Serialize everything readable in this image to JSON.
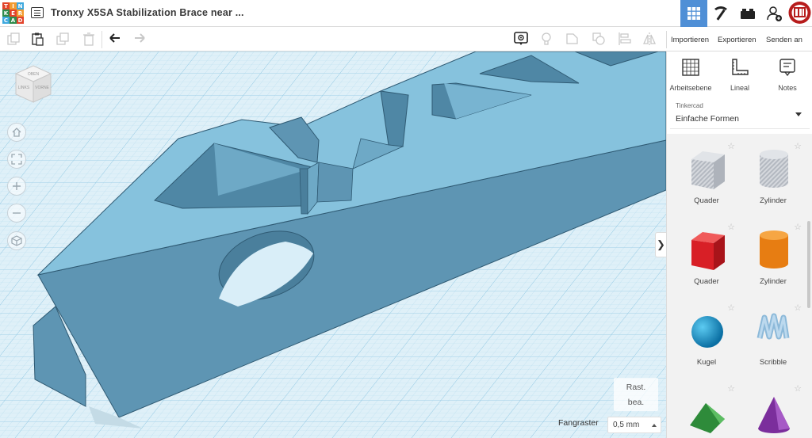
{
  "app": {
    "logo_letters": [
      "T",
      "I",
      "N",
      "K",
      "E",
      "R",
      "C",
      "A",
      "D"
    ],
    "logo_colors": [
      "#e2432a",
      "#f29b30",
      "#3ea8de",
      "#2f8c4c",
      "#e2432a",
      "#f29b30",
      "#3ea8de",
      "#2f8c4c",
      "#e2432a"
    ],
    "document_title": "Tronxy X5SA Stabilization Brace near ..."
  },
  "header_buttons": [
    {
      "name": "3d-design-view-button",
      "icon": "grid-icon",
      "active": true
    },
    {
      "name": "codeblocks-button",
      "icon": "pickaxe-icon",
      "active": false
    },
    {
      "name": "bricks-button",
      "icon": "brick-icon",
      "active": false
    },
    {
      "name": "add-user-button",
      "icon": "add-user-icon",
      "active": false
    }
  ],
  "toolbar": {
    "import_label": "Importieren",
    "export_label": "Exportieren",
    "send_label": "Senden an"
  },
  "viewport": {
    "navcube_faces": [
      "OBEN",
      "LINKS",
      "VORNE"
    ],
    "rast_label": "Rast.",
    "bea_label": "bea.",
    "snap_label": "Fangraster",
    "snap_value": "0,5 mm",
    "collapse_glyph": "❯"
  },
  "sidebar": {
    "tools": [
      {
        "label": "Arbeitsebene",
        "icon": "workplane-icon"
      },
      {
        "label": "Lineal",
        "icon": "ruler-icon"
      },
      {
        "label": "Notes",
        "icon": "notes-icon"
      }
    ],
    "library_source": "Tinkercad",
    "library_name": "Einfache Formen",
    "shapes": [
      {
        "label": "Quader",
        "icon": "hole-box-icon",
        "color": "#c9cdd4"
      },
      {
        "label": "Zylinder",
        "icon": "hole-cylinder-icon",
        "color": "#c9cdd4"
      },
      {
        "label": "Quader",
        "icon": "box-icon",
        "color": "#e0262b"
      },
      {
        "label": "Zylinder",
        "icon": "cylinder-icon",
        "color": "#f08a1d"
      },
      {
        "label": "Kugel",
        "icon": "sphere-icon",
        "color": "#1aa0d8"
      },
      {
        "label": "Scribble",
        "icon": "scribble-icon",
        "color": "#9fc4e0"
      },
      {
        "label": "",
        "icon": "roof-icon",
        "color": "#3aa34a"
      },
      {
        "label": "",
        "icon": "cone-icon",
        "color": "#8a3aa8"
      }
    ]
  }
}
